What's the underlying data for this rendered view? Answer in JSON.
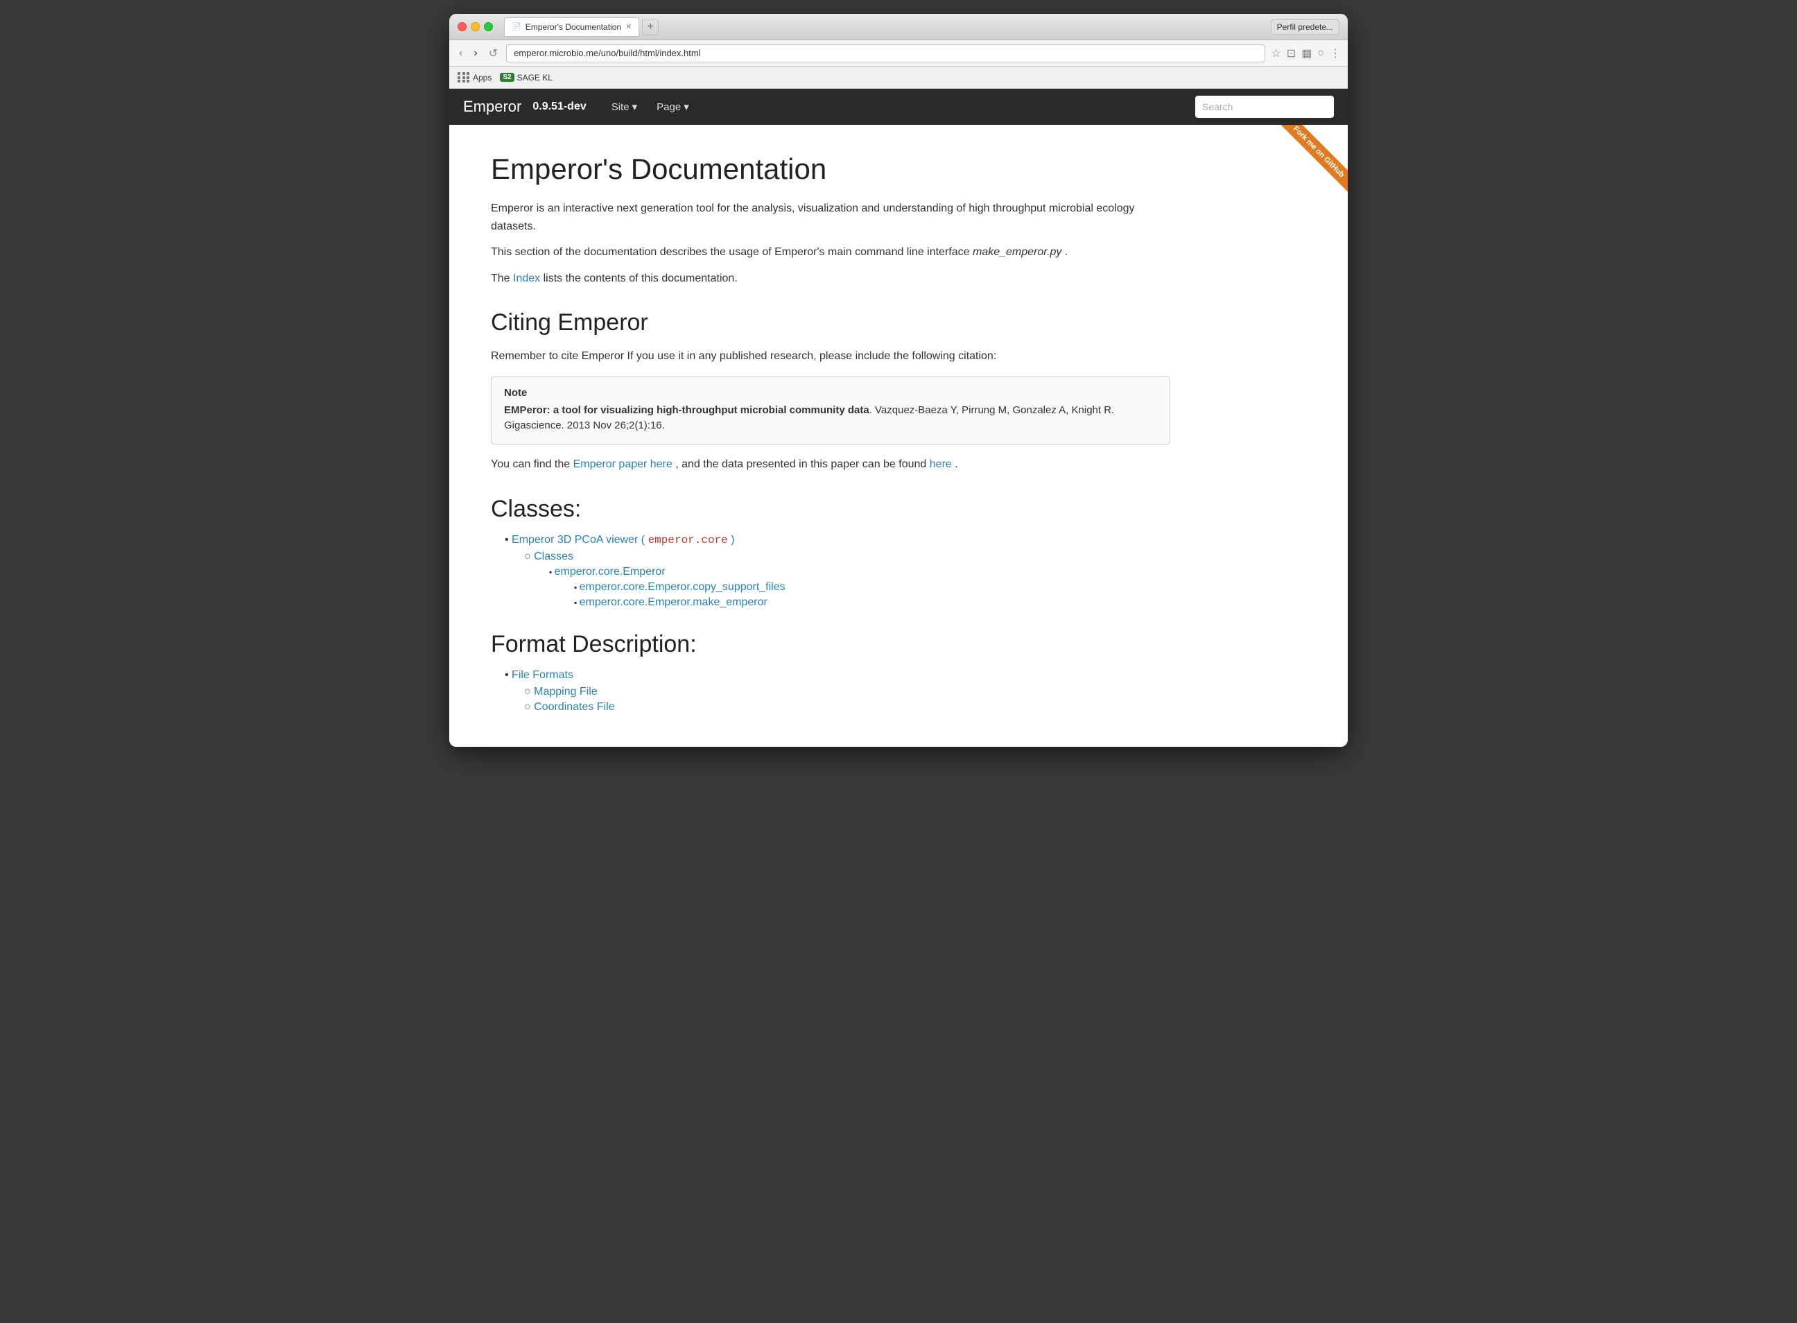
{
  "browser": {
    "tab_title": "Emperor's Documentation",
    "url": "emperor.microbio.me/uno/build/html/index.html",
    "profile_label": "Perfil predete...",
    "new_tab_symbol": "+",
    "nav_back": "‹",
    "nav_forward": "›",
    "nav_refresh": "↺"
  },
  "bookmarks": {
    "apps_label": "Apps",
    "sage_label": "SAGE KL"
  },
  "sitenav": {
    "brand": "Emperor",
    "version": "0.9.51-dev",
    "site_link": "Site",
    "page_link": "Page",
    "search_placeholder": "Search"
  },
  "fork_ribbon": "Fork me on GitHub",
  "content": {
    "page_title": "Emperor's Documentation",
    "intro_1": "Emperor is an interactive next generation tool for the analysis, visualization and understanding of high throughput microbial ecology datasets.",
    "intro_2": "This section of the documentation describes the usage of Emperor's main command line interface",
    "intro_2_code": "make_emperor.py",
    "intro_3_prefix": "The ",
    "intro_3_link": "Index",
    "intro_3_suffix": " lists the contents of this documentation.",
    "citing_title": "Citing Emperor",
    "citing_text": "Remember to cite Emperor If you use it in any published research, please include the following citation:",
    "note_label": "Note",
    "note_bold": "EMPeror: a tool for visualizing high-throughput microbial community data",
    "note_rest": ". Vazquez-Baeza Y, Pirrung M, Gonzalez A, Knight R. Gigascience. 2013 Nov 26;2(1):16.",
    "paper_prefix": "You can find the ",
    "paper_link1": "Emperor paper here",
    "paper_middle": ", and the data presented in this paper can be found ",
    "paper_link2": "here",
    "paper_suffix": ".",
    "classes_title": "Classes:",
    "classes_items": [
      {
        "label": "Emperor 3D PCoA viewer ( ",
        "code": "emperor.core",
        "label_end": " )",
        "link": true,
        "children": [
          {
            "label": "Classes",
            "link": true,
            "children": [
              {
                "label": "emperor.core.Emperor",
                "link": true,
                "children": [
                  {
                    "label": "emperor.core.Emperor.copy_support_files",
                    "link": true
                  },
                  {
                    "label": "emperor.core.Emperor.make_emperor",
                    "link": true
                  }
                ]
              }
            ]
          }
        ]
      }
    ],
    "format_title": "Format Description:",
    "format_items": [
      {
        "label": "File Formats",
        "link": true,
        "children": [
          {
            "label": "Mapping File",
            "link": true
          },
          {
            "label": "Coordinates File",
            "link": true
          }
        ]
      }
    ]
  }
}
